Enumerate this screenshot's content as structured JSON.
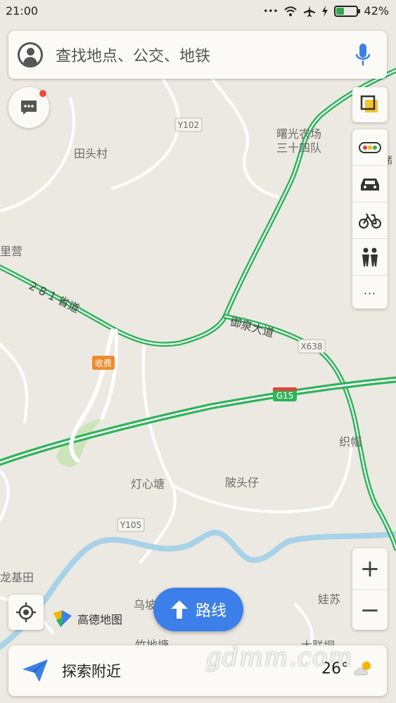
{
  "status_bar": {
    "time": "21:00",
    "battery_pct": "42%",
    "battery_level": 0.42
  },
  "search": {
    "placeholder": "查找地点、公交、地铁"
  },
  "map": {
    "labels": {
      "y102": "Y102",
      "tiantou": "田头村",
      "shuguang1": "曙光农场",
      "shuguang2": "三十四队",
      "liying": "里营",
      "prov_road": "2 8 1 省道",
      "yuquan": "御泉大道",
      "x638": "X638",
      "toll": "收费",
      "g15": "G15",
      "zhimao": "织帽",
      "dengxin": "灯心塘",
      "shantou": "陂头仔",
      "y105": "Y105",
      "longji": "龙基田",
      "wupo": "乌坡",
      "wasu": "娃苏",
      "zhudi": "竹地塘",
      "dalian": "大联垌",
      "edge_chu": "储"
    }
  },
  "tools": {
    "layers": "layers-icon",
    "traffic": "traffic-icon",
    "taxi": "taxi-icon",
    "bike": "bike-icon",
    "people": "people-icon",
    "more": "···"
  },
  "zoom": {
    "in": "+",
    "out": "−"
  },
  "logo": {
    "text": "高德地图"
  },
  "route_button": {
    "label": "路线"
  },
  "bottom_bar": {
    "explore_label": "探索附近",
    "temperature": "26°"
  },
  "watermark": "gdmm.com",
  "colors": {
    "road_green": "#2fb45a",
    "accent_blue": "#3c7fe8",
    "river": "#a8d2e8",
    "map_bg": "#ece9e2"
  }
}
